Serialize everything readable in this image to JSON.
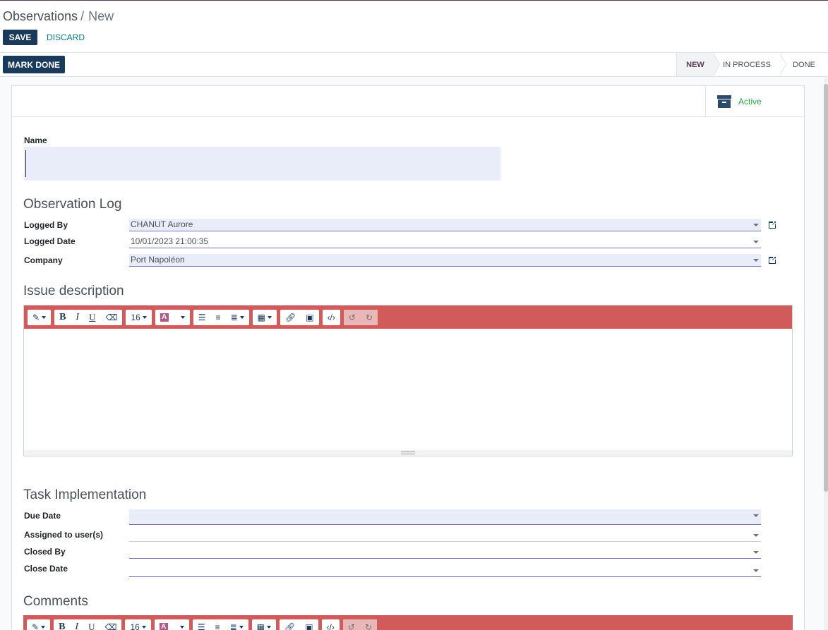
{
  "breadcrumb": {
    "parent": "Observations",
    "separator": "/",
    "current": "New"
  },
  "actions": {
    "save": "SAVE",
    "discard": "DISCARD",
    "mark_done": "MARK DONE"
  },
  "stages": [
    "NEW",
    "IN PROCESS",
    "DONE"
  ],
  "active_stage": "NEW",
  "smart_button": {
    "label": "Active",
    "icon": "archive-icon"
  },
  "form": {
    "name_label": "Name",
    "name_value": "",
    "observation_log": {
      "title": "Observation Log",
      "logged_by": {
        "label": "Logged By",
        "value": "CHANUT Aurore"
      },
      "logged_date": {
        "label": "Logged Date",
        "value": "10/01/2023 21:00:35"
      },
      "company": {
        "label": "Company",
        "value": "Port Napoléon"
      }
    },
    "issue_description": {
      "title": "Issue description",
      "font_size": "16"
    },
    "task_implementation": {
      "title": "Task Implementation",
      "due_date": {
        "label": "Due Date",
        "value": ""
      },
      "assigned": {
        "label": "Assigned to user(s)",
        "value": ""
      },
      "closed_by": {
        "label": "Closed By",
        "value": ""
      },
      "close_date": {
        "label": "Close Date",
        "value": ""
      }
    },
    "comments": {
      "title": "Comments",
      "font_size": "16"
    }
  },
  "colors": {
    "primary": "#1a3a5c",
    "toolbar": "#d15b5b",
    "link": "#017e84",
    "active": "#28a745",
    "input_fill": "#e9edf9"
  }
}
